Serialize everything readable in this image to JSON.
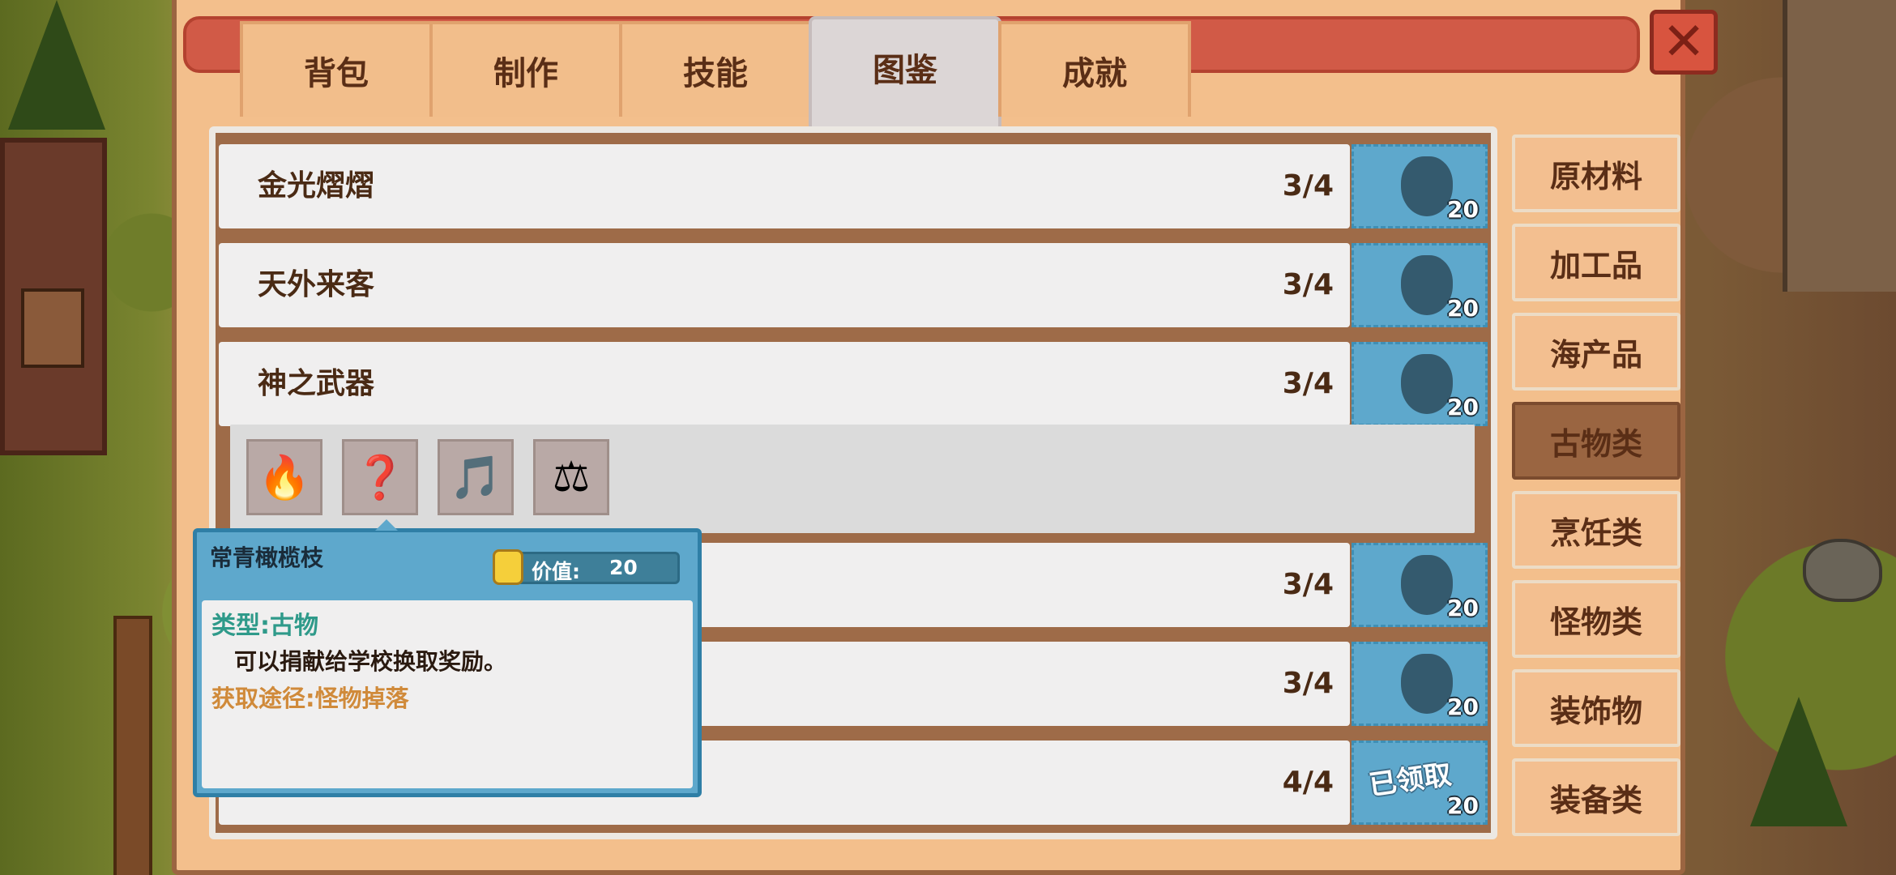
{
  "tabs": [
    {
      "label": "背包"
    },
    {
      "label": "制作"
    },
    {
      "label": "技能"
    },
    {
      "label": "图鉴"
    },
    {
      "label": "成就"
    }
  ],
  "close_icon": "close-x-icon",
  "rows": [
    {
      "name": "金光熠熠",
      "count": "3/4",
      "reward_qty": "20"
    },
    {
      "name": "天外来客",
      "count": "3/4",
      "reward_qty": "20"
    },
    {
      "name": "神之武器",
      "count": "3/4",
      "reward_qty": "20"
    },
    {
      "name": "",
      "count": "3/4",
      "reward_qty": "20"
    },
    {
      "name": "",
      "count": "3/4",
      "reward_qty": "20"
    },
    {
      "name": "",
      "count": "4/4",
      "reward_qty": "20",
      "claimed": "已领取"
    }
  ],
  "expanded_items": [
    {
      "icon": "torch-icon",
      "glyph": "🔥"
    },
    {
      "icon": "unknown-silhouette-icon",
      "glyph": "❓"
    },
    {
      "icon": "lyre-icon",
      "glyph": "🎵"
    },
    {
      "icon": "golden-scale-icon",
      "glyph": "⚖"
    }
  ],
  "categories": [
    {
      "label": "原材料"
    },
    {
      "label": "加工品"
    },
    {
      "label": "海产品"
    },
    {
      "label": "古物类"
    },
    {
      "label": "烹饪类"
    },
    {
      "label": "怪物类"
    },
    {
      "label": "装饰物"
    },
    {
      "label": "装备类"
    }
  ],
  "tooltip": {
    "name": "常青橄榄枝",
    "value_label": "价值:",
    "value": "20",
    "type": "类型:古物",
    "description": "可以捐献给学校换取奖励。",
    "source": "获取途径:怪物掉落"
  },
  "colors": {
    "panel": "#f3bf8c",
    "title_bar": "#d15a47",
    "reward_bg": "#5ea8cc",
    "active_category": "#9a6541"
  }
}
